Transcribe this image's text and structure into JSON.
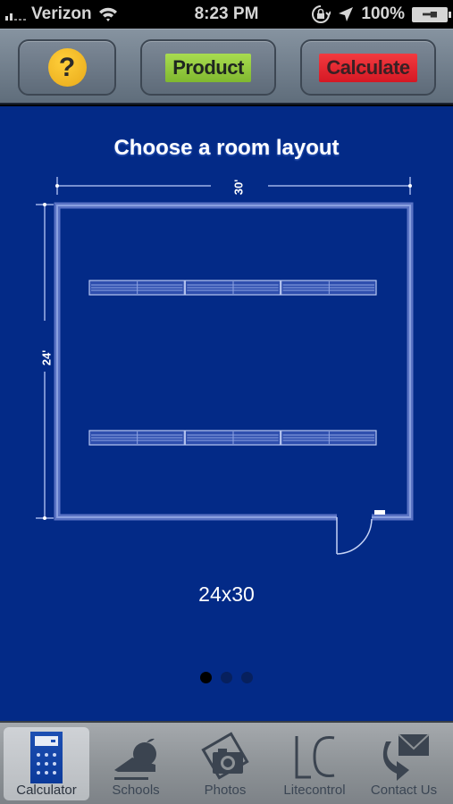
{
  "status_bar": {
    "carrier": "Verizon",
    "time": "8:23 PM",
    "battery": "100%",
    "icons": [
      "signal-icon",
      "wifi-icon",
      "rotation-lock-icon",
      "location-icon",
      "battery-charging-icon"
    ]
  },
  "toolbar": {
    "help_label": "?",
    "product_label": "Product",
    "calculate_label": "Calculate",
    "colors": {
      "product": "#95cb40",
      "calculate": "#e8262f",
      "help": "#f4b823"
    }
  },
  "main": {
    "title": "Choose a room layout",
    "width_label": "30'",
    "height_label": "24'",
    "layout_name": "24x30",
    "pager": {
      "total": 3,
      "current": 1
    },
    "fixture_rows": 2,
    "fixtures_per_row": 3,
    "background": "#032a87"
  },
  "tabbar": {
    "tabs": [
      {
        "label": "Calculator",
        "icon": "calculator-icon",
        "active": true
      },
      {
        "label": "Schools",
        "icon": "schools-icon",
        "active": false
      },
      {
        "label": "Photos",
        "icon": "camera-icon",
        "active": false
      },
      {
        "label": "Litecontrol",
        "icon": "lc-logo-icon",
        "active": false
      },
      {
        "label": "Contact Us",
        "icon": "mail-forward-icon",
        "active": false
      }
    ]
  }
}
